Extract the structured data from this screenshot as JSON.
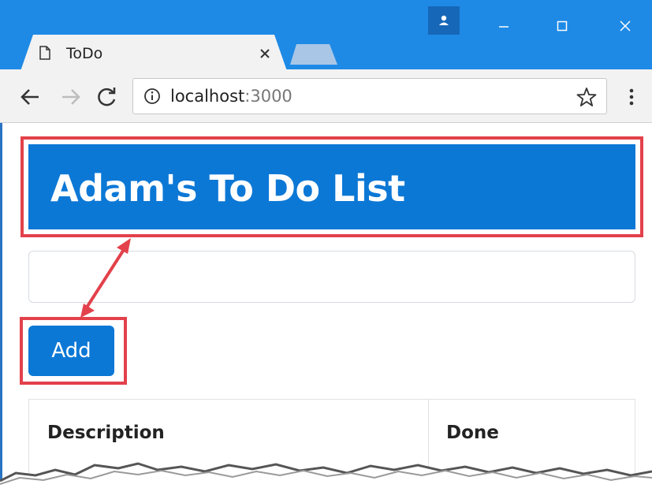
{
  "browser": {
    "tab": {
      "title": "ToDo"
    },
    "address": {
      "host": "localhost",
      "port_suffix": ":3000"
    }
  },
  "page": {
    "header_title": "Adam's To Do List",
    "input_value": "",
    "add_button_label": "Add",
    "table_headers": [
      "Description",
      "Done"
    ]
  },
  "colors": {
    "banner": "#0c78d6",
    "highlight": "#e3414b",
    "titlebar": "#1e8ae6"
  }
}
